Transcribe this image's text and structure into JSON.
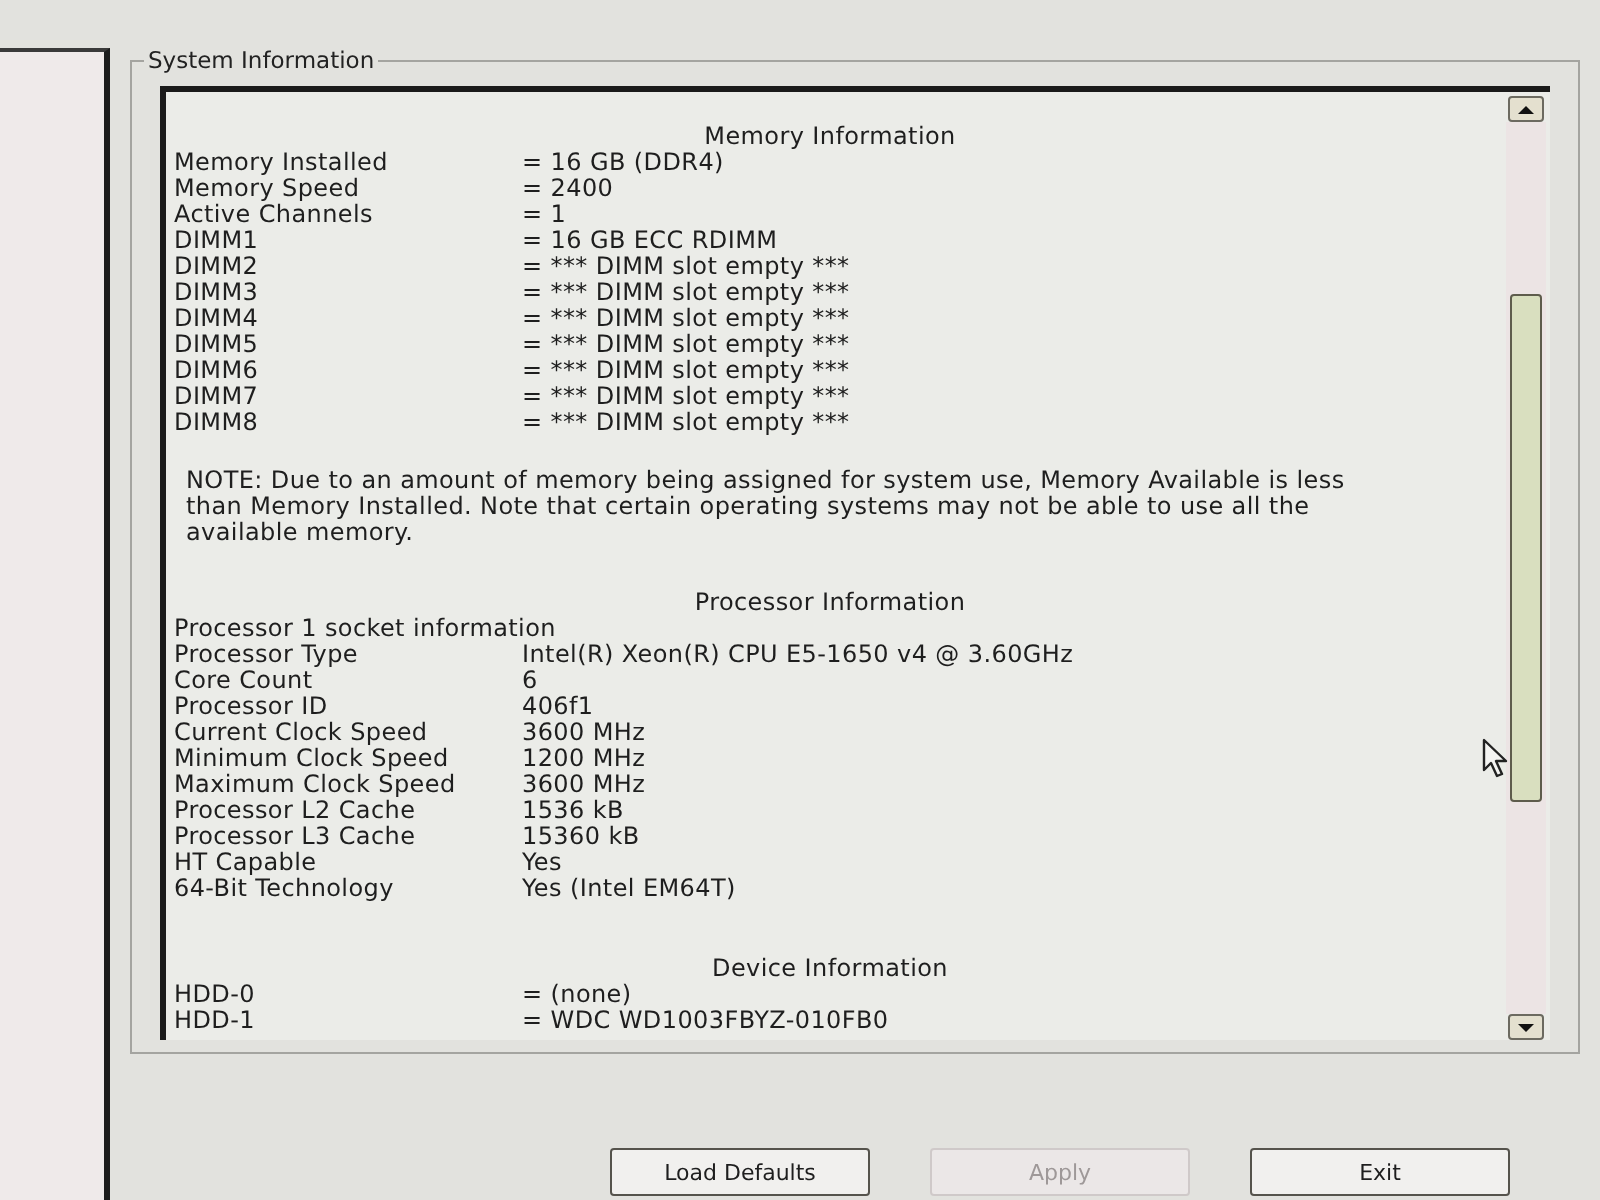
{
  "group": {
    "title": "System Information"
  },
  "sections": [
    {
      "heading": "Memory Information",
      "rows": [
        {
          "label": "Memory Installed",
          "value": "= 16 GB (DDR4)"
        },
        {
          "label": "Memory Speed",
          "value": "= 2400"
        },
        {
          "label": "Active Channels",
          "value": "= 1"
        },
        {
          "label": "DIMM1",
          "value": "= 16 GB ECC RDIMM"
        },
        {
          "label": "DIMM2",
          "value": "= *** DIMM slot empty ***"
        },
        {
          "label": "DIMM3",
          "value": "= *** DIMM slot empty ***"
        },
        {
          "label": "DIMM4",
          "value": "= *** DIMM slot empty ***"
        },
        {
          "label": "DIMM5",
          "value": "= *** DIMM slot empty ***"
        },
        {
          "label": "DIMM6",
          "value": "= *** DIMM slot empty ***"
        },
        {
          "label": "DIMM7",
          "value": "= *** DIMM slot empty ***"
        },
        {
          "label": "DIMM8",
          "value": "= *** DIMM slot empty ***"
        }
      ],
      "note": "NOTE: Due to an amount of memory being assigned for system use, Memory Available is less than Memory Installed. Note that certain operating systems may not be able to use all the available memory."
    },
    {
      "heading": "Processor Information",
      "subheading": "Processor 1 socket information",
      "rows": [
        {
          "label": "Processor Type",
          "value": "Intel(R) Xeon(R) CPU E5-1650 v4 @ 3.60GHz"
        },
        {
          "label": "Core Count",
          "value": "6"
        },
        {
          "label": "Processor ID",
          "value": "406f1"
        },
        {
          "label": "Current Clock Speed",
          "value": "3600 MHz"
        },
        {
          "label": "Minimum Clock Speed",
          "value": "1200 MHz"
        },
        {
          "label": "Maximum Clock Speed",
          "value": "3600 MHz"
        },
        {
          "label": "Processor L2 Cache",
          "value": "1536 kB"
        },
        {
          "label": "Processor L3 Cache",
          "value": "15360 kB"
        },
        {
          "label": "HT Capable",
          "value": "Yes"
        },
        {
          "label": "64-Bit Technology",
          "value": "Yes (Intel EM64T)"
        }
      ]
    },
    {
      "heading": "Device Information",
      "rows": [
        {
          "label": "HDD-0",
          "value": "= (none)"
        },
        {
          "label": "HDD-1",
          "value": "= WDC WD1003FBYZ-010FB0"
        }
      ]
    }
  ],
  "buttons": [
    {
      "label": "Load Defaults",
      "disabled": false
    },
    {
      "label": "Apply",
      "disabled": true
    },
    {
      "label": "Exit",
      "disabled": false
    }
  ]
}
